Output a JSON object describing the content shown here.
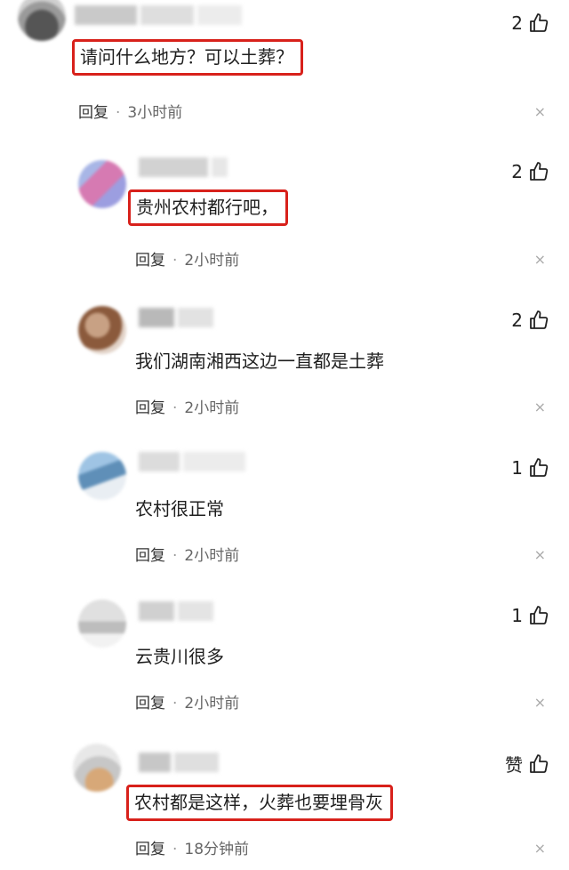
{
  "comments": [
    {
      "text": "请问什么地方？可以土葬？",
      "reply_label": "回复",
      "separator": "·",
      "time": "3小时前",
      "likes": "2",
      "close_glyph": "×"
    },
    {
      "text": "贵州农村都行吧，",
      "reply_label": "回复",
      "separator": "·",
      "time": "2小时前",
      "likes": "2",
      "close_glyph": "×"
    },
    {
      "text": "我们湖南湘西这边一直都是土葬",
      "reply_label": "回复",
      "separator": "·",
      "time": "2小时前",
      "likes": "2",
      "close_glyph": "×"
    },
    {
      "text": "农村很正常",
      "reply_label": "回复",
      "separator": "·",
      "time": "2小时前",
      "likes": "1",
      "close_glyph": "×"
    },
    {
      "text": "云贵川很多",
      "reply_label": "回复",
      "separator": "·",
      "time": "2小时前",
      "likes": "1",
      "close_glyph": "×"
    },
    {
      "text": "农村都是这样，火葬也要埋骨灰",
      "reply_label": "回复",
      "separator": "·",
      "time": "18分钟前",
      "likes": "赞",
      "close_glyph": "×"
    }
  ],
  "colors": {
    "highlight_box": "#d8211b",
    "thumb_icon": "#222222"
  }
}
